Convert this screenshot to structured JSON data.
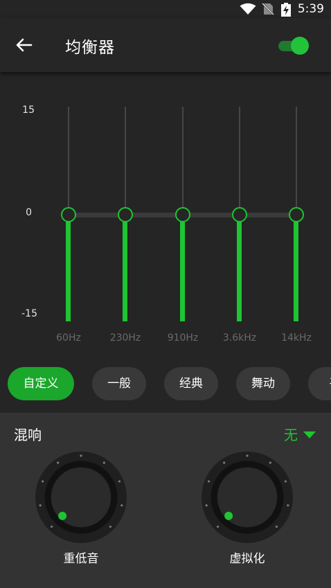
{
  "status_bar": {
    "time": "5:39",
    "icons": [
      "wifi-icon",
      "no-sim-icon",
      "battery-charging-icon"
    ]
  },
  "app_bar": {
    "back_icon": "arrow-left-icon",
    "title": "均衡器",
    "enabled": true
  },
  "equalizer": {
    "db_labels": [
      "15",
      "0",
      "-15"
    ],
    "bands": [
      {
        "freq": "60Hz",
        "gain": 0
      },
      {
        "freq": "230Hz",
        "gain": 0
      },
      {
        "freq": "910Hz",
        "gain": 0
      },
      {
        "freq": "3.6kHz",
        "gain": 0
      },
      {
        "freq": "14kHz",
        "gain": 0
      }
    ]
  },
  "presets": {
    "items": [
      "自定义",
      "一般",
      "经典",
      "舞动",
      "平"
    ],
    "active": "自定义"
  },
  "reverb": {
    "title": "混响",
    "value": "无",
    "knobs": [
      {
        "label": "重低音",
        "level": 0
      },
      {
        "label": "虚拟化",
        "level": 0
      }
    ]
  },
  "colors": {
    "accent": "#1ec432",
    "background": "#252525",
    "panel": "#333333",
    "chip": "#393939"
  }
}
